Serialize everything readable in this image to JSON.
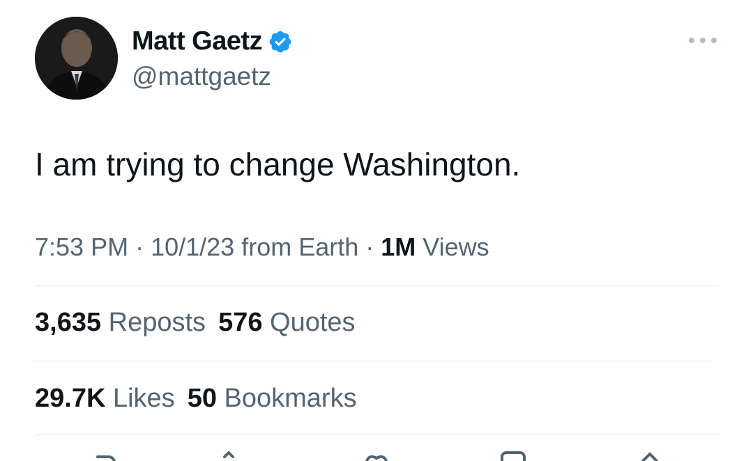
{
  "author": {
    "name": "Matt Gaetz",
    "handle": "@mattgaetz",
    "verified": true
  },
  "tweet": {
    "text": "I am trying to change Washington."
  },
  "meta": {
    "time": "7:53 PM",
    "separator1": " · ",
    "date": "10/1/23",
    "source": " from Earth",
    "separator2": " · ",
    "views_count": "1M",
    "views_label": " Views"
  },
  "stats": {
    "reposts_count": "3,635",
    "reposts_label": "Reposts",
    "quotes_count": "576",
    "quotes_label": "Quotes",
    "likes_count": "29.7K",
    "likes_label": "Likes",
    "bookmarks_count": "50",
    "bookmarks_label": "Bookmarks"
  },
  "icons": {
    "verified": "verified-badge-icon",
    "more": "more-options-icon",
    "actions": [
      "reply-icon",
      "repost-icon",
      "like-icon",
      "bookmark-icon",
      "share-icon"
    ]
  },
  "colors": {
    "verified_blue": "#1d9bf0",
    "text_primary": "#0f1419",
    "text_secondary": "#536471",
    "divider": "#e1e6ea"
  }
}
